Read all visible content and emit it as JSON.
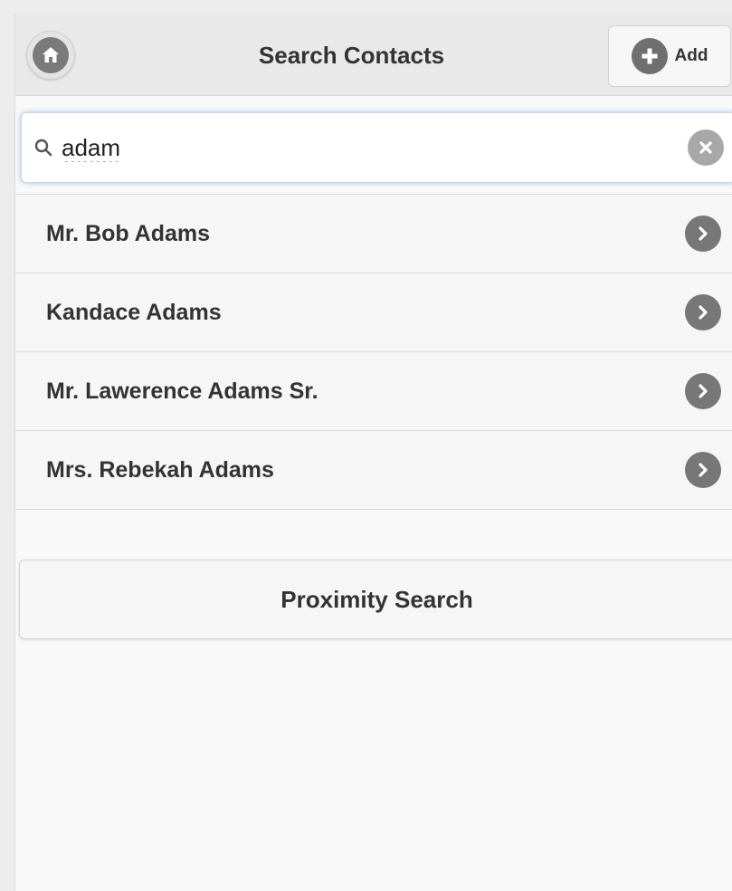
{
  "header": {
    "title": "Search Contacts",
    "add_label": "Add"
  },
  "search": {
    "value": "adam",
    "placeholder": ""
  },
  "contacts": [
    {
      "name": "Mr. Bob Adams"
    },
    {
      "name": "Kandace Adams"
    },
    {
      "name": "Mr. Lawerence Adams Sr."
    },
    {
      "name": "Mrs. Rebekah Adams"
    }
  ],
  "proximity": {
    "label": "Proximity Search"
  },
  "colors": {
    "icon_fill": "#777777",
    "clear_fill": "#a8a8a8",
    "focus_glow": "#5a96d2"
  },
  "icons": [
    "home-icon",
    "plus-icon",
    "search-icon",
    "clear-icon",
    "chevron-right-icon"
  ]
}
